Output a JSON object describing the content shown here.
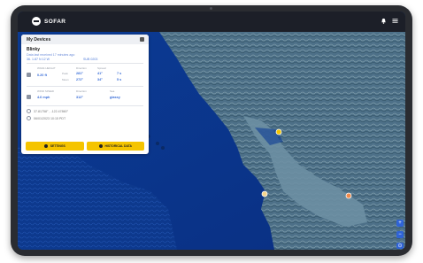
{
  "app": {
    "brand": "SOFAR",
    "icons": [
      "notification-icon",
      "menu-icon"
    ]
  },
  "panel": {
    "title": "My Devices",
    "device_name": "Blinky",
    "updated": "Data last received 17 minutes ago",
    "coords": "36. 1.87 N 12 W",
    "subscription": "SUB 0203",
    "metrics": {
      "wave_label": "WAVE HEIGHT",
      "wave_value": "0.20 ft",
      "peak_period_label": "Peak",
      "peak_period_value": "7 s",
      "mean_period_label": "Mean",
      "mean_period_value": "5 s",
      "dir_label": "Direction",
      "dir1": "281°",
      "dir2": "272°",
      "spread_label": "Spread",
      "spread1": "41°",
      "spread2": "34°",
      "wind_label": "WIND SPEED",
      "wind_value": "4.6 mph",
      "wind_dir_label": "Direction",
      "wind_dir_value": "312°",
      "sea_label": "Sea",
      "sea_value": "glassy"
    },
    "info_rows": [
      "37.81758° , -122.47860°",
      "06/01/2023 10:15 PDT"
    ],
    "buttons": {
      "settings": "SETTINGS",
      "historical": "HISTORICAL DATA"
    }
  },
  "map_controls": [
    "+",
    "−",
    "⊙"
  ],
  "colors": {
    "ocean": "#0b3b94",
    "land": "#3a5f74",
    "accent": "#f5c400",
    "topbar": "#1c1f28"
  }
}
